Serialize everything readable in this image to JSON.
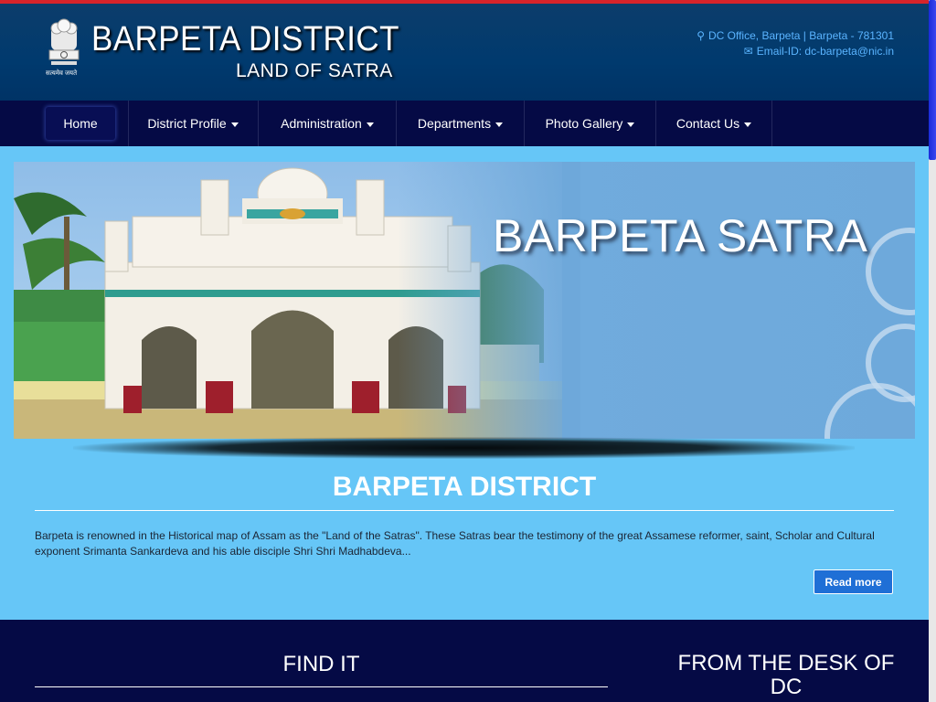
{
  "header": {
    "title": "BARPETA DISTRICT",
    "subtitle": "LAND OF SATRA",
    "emblem_motto": "सत्यमेव जयते",
    "address": "DC Office, Barpeta | Barpeta - 781301",
    "email": "Email-ID: dc-barpeta@nic.in",
    "address_icon": "map-marker-icon",
    "email_icon": "envelope-icon"
  },
  "nav": {
    "items": [
      {
        "label": "Home"
      },
      {
        "label": "District Profile"
      },
      {
        "label": "Administration"
      },
      {
        "label": "Departments"
      },
      {
        "label": "Photo Gallery"
      },
      {
        "label": "Contact Us"
      }
    ]
  },
  "banner": {
    "title": "BARPETA SATRA"
  },
  "intro": {
    "title": "BARPETA DISTRICT",
    "text": "Barpeta is renowned in the Historical map of Assam as the \"Land of the Satras\". These Satras bear the testimony of the great Assamese reformer, saint, Scholar and Cultural exponent Srimanta Sankardeva and his able disciple Shri Shri Madhabdeva...",
    "read_more": "Read more"
  },
  "bottom": {
    "find_it": "FIND IT",
    "desk_title": "FROM THE DESK OF DC"
  },
  "colors": {
    "header_bg": "#003a6e",
    "nav_bg": "#050a45",
    "body_bg": "#66c6f7",
    "accent_red": "#d8242a",
    "button_blue": "#1f6fd6"
  }
}
